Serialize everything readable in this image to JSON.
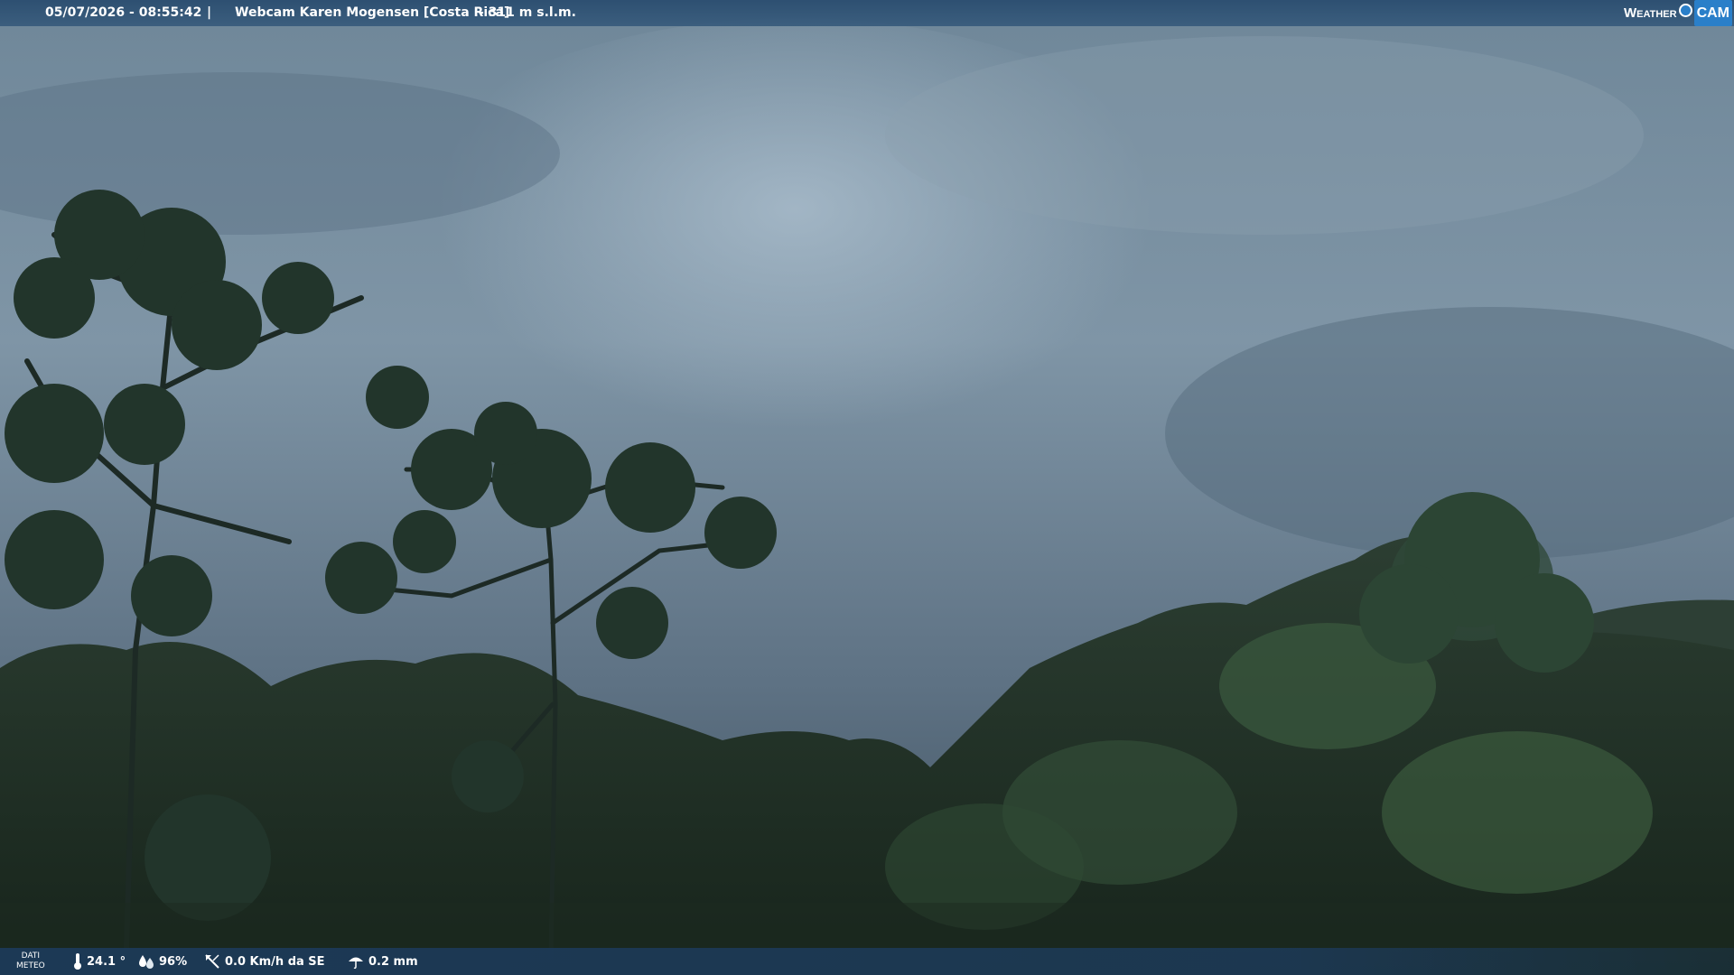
{
  "header": {
    "timestamp": "05/07/2026 - 08:55:42",
    "separator": "|",
    "title": "Webcam Karen Mogensen [Costa Rica]",
    "altitude": "- 311 m s.l.m.",
    "logo_weather": "Weather",
    "logo_cam": "CAM"
  },
  "footer": {
    "label_line1": "DATI",
    "label_line2": "METEO",
    "temperature": "24.1 °",
    "humidity": "96%",
    "wind": "0.0 Km/h da SE",
    "rain": "0.2 mm"
  },
  "icons": {
    "temperature": "thermometer-icon",
    "humidity": "humidity-drops-icon",
    "wind": "wind-vane-icon",
    "rain": "rain-umbrella-icon"
  },
  "colors": {
    "bar": "#284b6e",
    "logo_accent": "#2a7fc9"
  }
}
